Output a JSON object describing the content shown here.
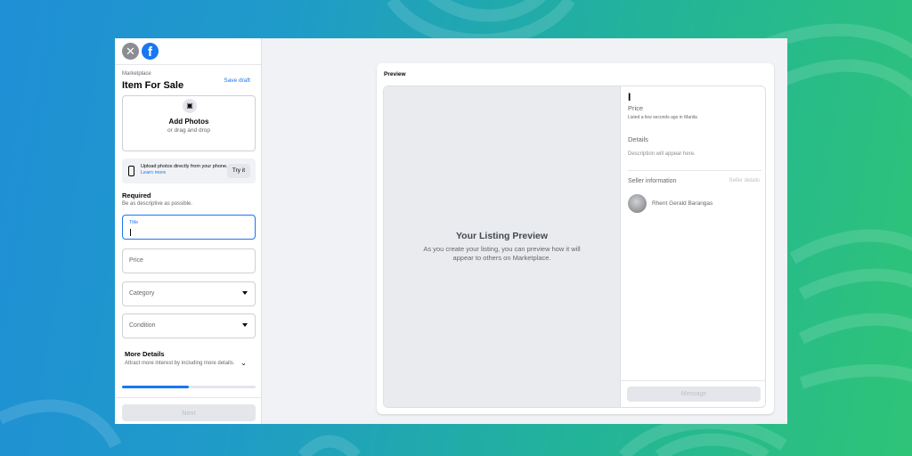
{
  "header": {
    "close_glyph": "✕",
    "logo_glyph": "f"
  },
  "form": {
    "breadcrumb": "Marketplace",
    "title": "Item For Sale",
    "save_draft": "Save draft",
    "photos": {
      "title": "Add Photos",
      "subtitle": "or drag and drop"
    },
    "phone_tip": {
      "text": "Upload photos directly from your phone.",
      "link": "Learn more",
      "button": "Try it"
    },
    "required": {
      "title": "Required",
      "subtitle": "Be as descriptive as possible."
    },
    "fields": {
      "title_label": "Title",
      "price_label": "Price",
      "category_label": "Category",
      "condition_label": "Condition"
    },
    "more_details": {
      "title": "More Details",
      "subtitle": "Attract more interest by including more details."
    },
    "progress_fraction": 0.5,
    "next_button": "Next"
  },
  "preview": {
    "heading": "Preview",
    "image_title": "Your Listing Preview",
    "image_text": "As you create your listing, you can preview how it will appear to others on Marketplace.",
    "listing_title": "I",
    "price": "Price",
    "listed": "Listed a few seconds ago in Manila",
    "details_heading": "Details",
    "description": "Description will appear here.",
    "seller_heading": "Seller information",
    "seller_details_link": "Seller details",
    "seller_name": "Rhent Gerald Barangas",
    "message_button": "Message"
  },
  "colors": {
    "accent": "#1877f2",
    "panel_bg": "#f0f2f5"
  }
}
